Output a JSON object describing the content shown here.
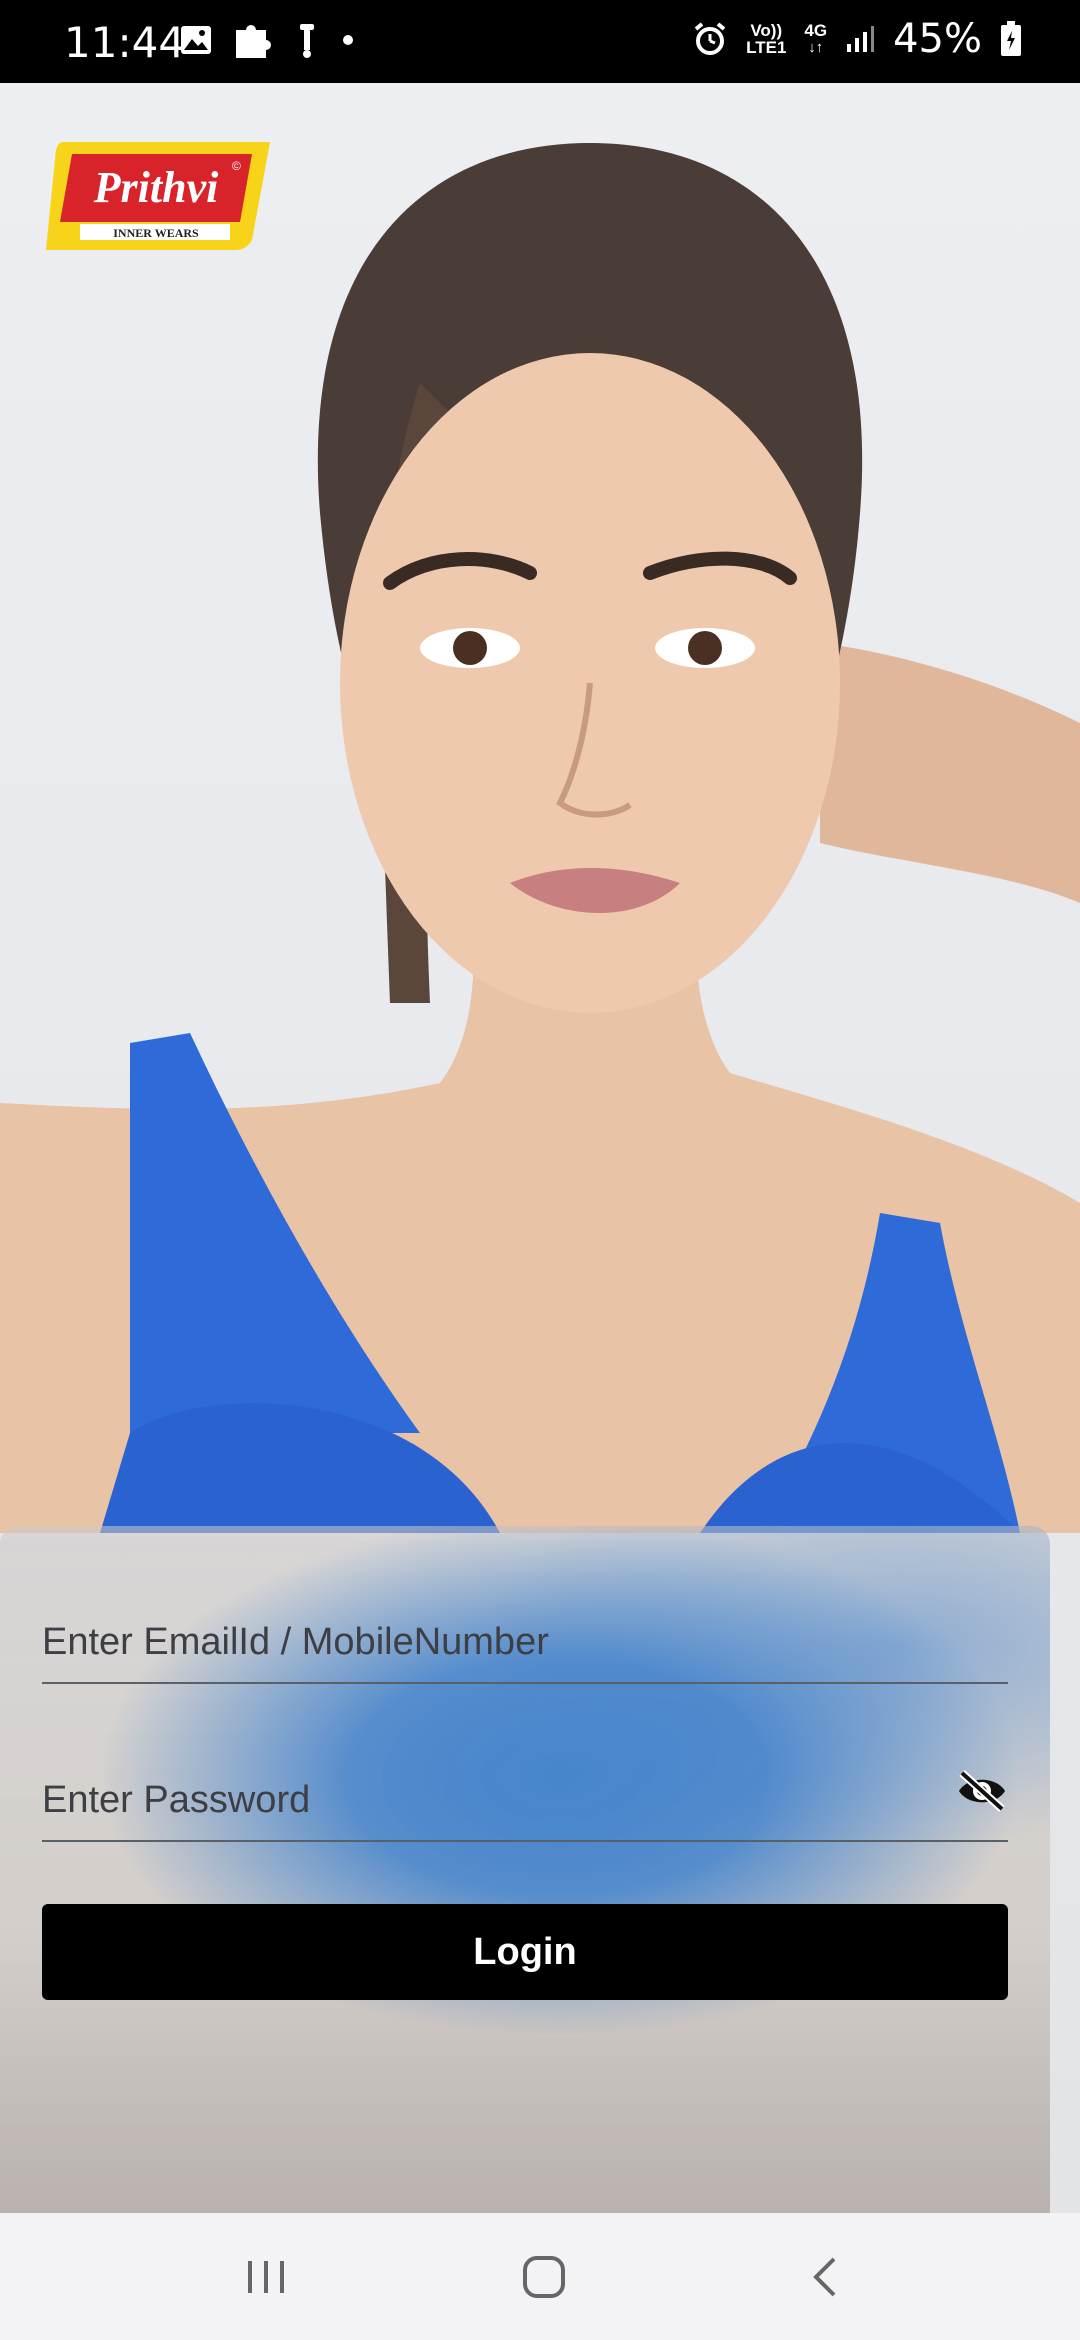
{
  "status_bar": {
    "time": "11:44",
    "left_icons": [
      "image-icon",
      "puzzle-icon",
      "scooter-icon",
      "dot-icon"
    ],
    "right_icons": [
      "alarm-icon",
      "volte-icon",
      "4g-icon",
      "signal-icon",
      "battery-icon"
    ],
    "volte_line1": "Vo))",
    "volte_line2": "LTE1",
    "network_type": "4G",
    "battery_percent": "45%"
  },
  "brand": {
    "name": "Prithvi",
    "tagline": "INNER WEARS",
    "copyright_mark": "©",
    "colors": {
      "badge": "#f7d419",
      "label": "#d8232a"
    }
  },
  "login": {
    "email_placeholder": "Enter EmailId / MobileNumber",
    "email_value": "",
    "password_placeholder": "Enter Password",
    "password_value": "",
    "toggle_icon": "eye-off-icon",
    "login_label": "Login",
    "colors": {
      "button": "#000000",
      "card_accent": "#3e80cc"
    }
  },
  "nav_bar": {
    "buttons": [
      "recent-apps-icon",
      "home-icon",
      "back-icon"
    ]
  }
}
